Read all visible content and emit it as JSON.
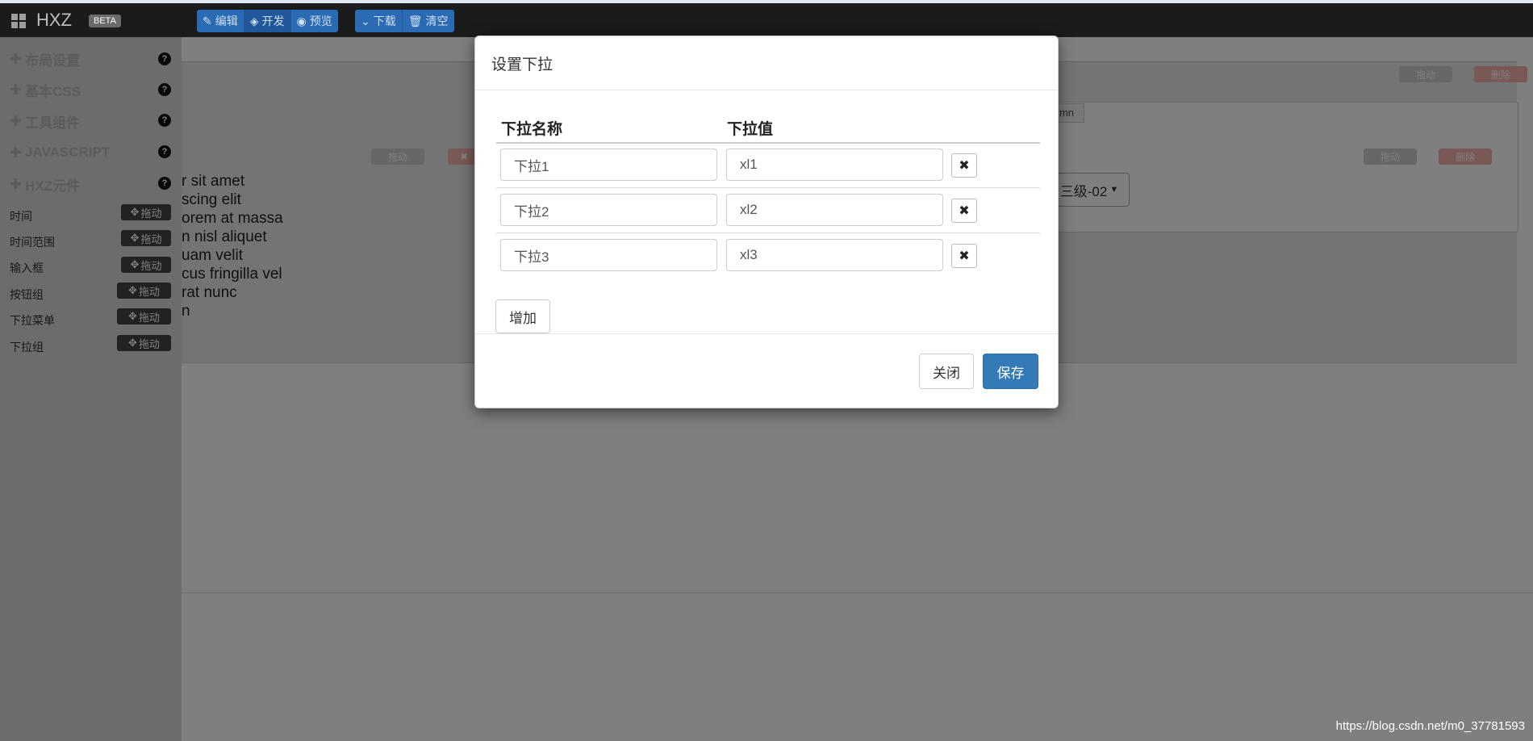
{
  "navbar": {
    "brand": "HXZ",
    "beta": "BETA",
    "edit_label": "编辑",
    "develop_label": "开发",
    "preview_label": "预览",
    "download_label": "下载",
    "clear_label": "清空",
    "icons": [
      "grid-icon",
      "edit-icon",
      "develop-icon",
      "eye-icon",
      "chevron-down-icon",
      "trash-icon"
    ]
  },
  "sidebar": {
    "headers": [
      {
        "label": "布局设置"
      },
      {
        "label": "基本CSS"
      },
      {
        "label": "工具组件"
      },
      {
        "label": "JAVASCRIPT"
      },
      {
        "label": "HXZ元件"
      }
    ],
    "items": [
      {
        "label": "时间",
        "drag": "拖动"
      },
      {
        "label": "时间范围",
        "drag": "拖动"
      },
      {
        "label": "输入框",
        "drag": "拖动"
      },
      {
        "label": "按钮组",
        "drag": "拖动"
      },
      {
        "label": "下拉菜单",
        "drag": "拖动"
      },
      {
        "label": "下拉组",
        "drag": "拖动"
      }
    ]
  },
  "background": {
    "lorem_lines": [
      "r sit amet",
      "scing elit",
      "orem at massa",
      "n nisl aliquet",
      "uam velit",
      "cus fringilla vel",
      "rat nunc",
      "n"
    ],
    "drag_label": "拖动",
    "delete_label": "删除",
    "column_tag": "mn",
    "dropdown_label": "三级-02"
  },
  "modal": {
    "title": "设置下拉",
    "col_name_header": "下拉名称",
    "col_value_header": "下拉值",
    "rows": [
      {
        "name": "下拉1",
        "value": "xl1"
      },
      {
        "name": "下拉2",
        "value": "xl2"
      },
      {
        "name": "下拉3",
        "value": "xl3"
      }
    ],
    "delete_glyph": "✖",
    "add_label": "增加",
    "close_label": "关闭",
    "save_label": "保存"
  },
  "watermark": "https://blog.csdn.net/m0_37781593",
  "colors": {
    "navbar_bg": "#1b1b1b",
    "nav_button": "#2a6bb3",
    "primary": "#337ab7",
    "backdrop": "rgba(0,0,0,0.5)"
  }
}
